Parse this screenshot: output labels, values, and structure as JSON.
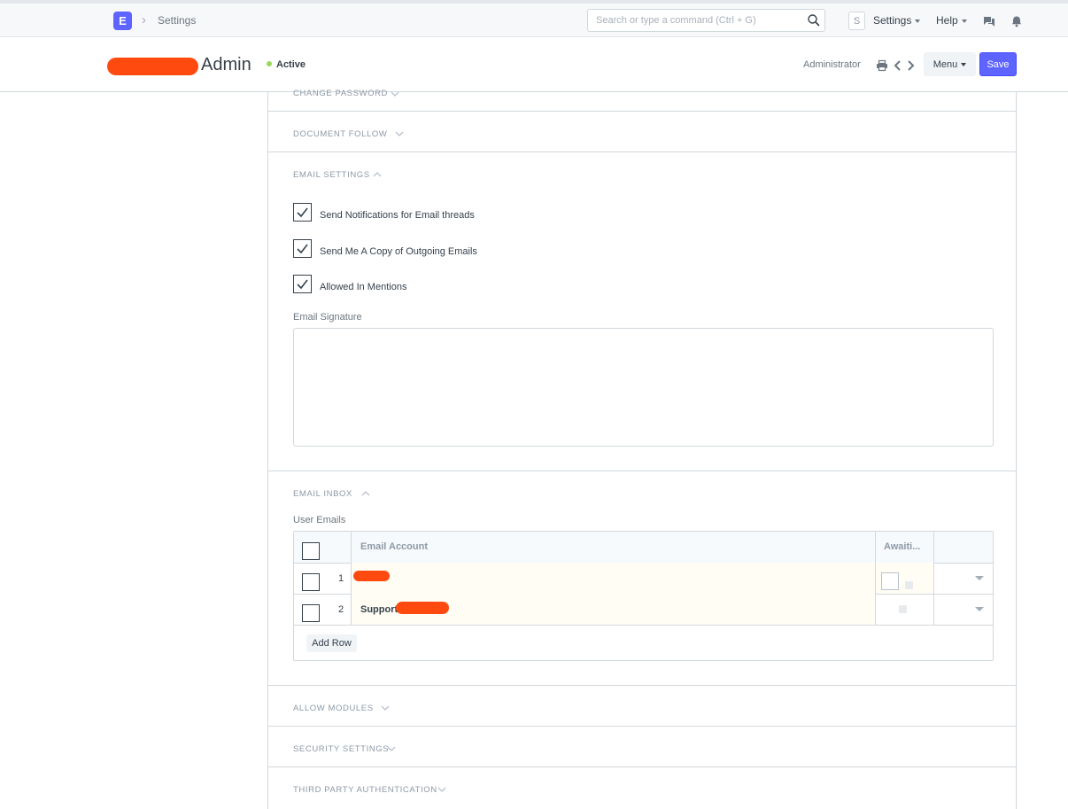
{
  "navbar": {
    "logo_letter": "E",
    "breadcrumb": "Settings",
    "search_placeholder": "Search or type a command (Ctrl + G)",
    "avatar_letter": "S",
    "settings_label": "Settings",
    "help_label": "Help"
  },
  "page_head": {
    "title": "Admin",
    "status": "Active",
    "owner": "Administrator",
    "menu_label": "Menu",
    "save_label": "Save",
    "accent_color": "#5e64ff",
    "status_color": "#98d85b"
  },
  "sections": {
    "change_password": "CHANGE PASSWORD",
    "document_follow": "DOCUMENT FOLLOW",
    "email_settings": "EMAIL SETTINGS",
    "email_inbox": "EMAIL INBOX",
    "allow_modules": "ALLOW MODULES",
    "security_settings": "SECURITY SETTINGS",
    "third_party_auth": "THIRD PARTY AUTHENTICATION"
  },
  "email_settings": {
    "options": [
      {
        "label": "Send Notifications for Email threads",
        "checked": true
      },
      {
        "label": "Send Me A Copy of Outgoing Emails",
        "checked": true
      },
      {
        "label": "Allowed In Mentions",
        "checked": true
      }
    ],
    "signature_label": "Email Signature",
    "signature_value": ""
  },
  "email_inbox": {
    "table_label": "User Emails",
    "columns": [
      "Email Account",
      "Awaiti..."
    ],
    "rows": [
      {
        "num": "1",
        "account": ""
      },
      {
        "num": "2",
        "account": "Support"
      }
    ],
    "add_row_label": "Add Row"
  },
  "redaction_color": "#ff4a0f"
}
